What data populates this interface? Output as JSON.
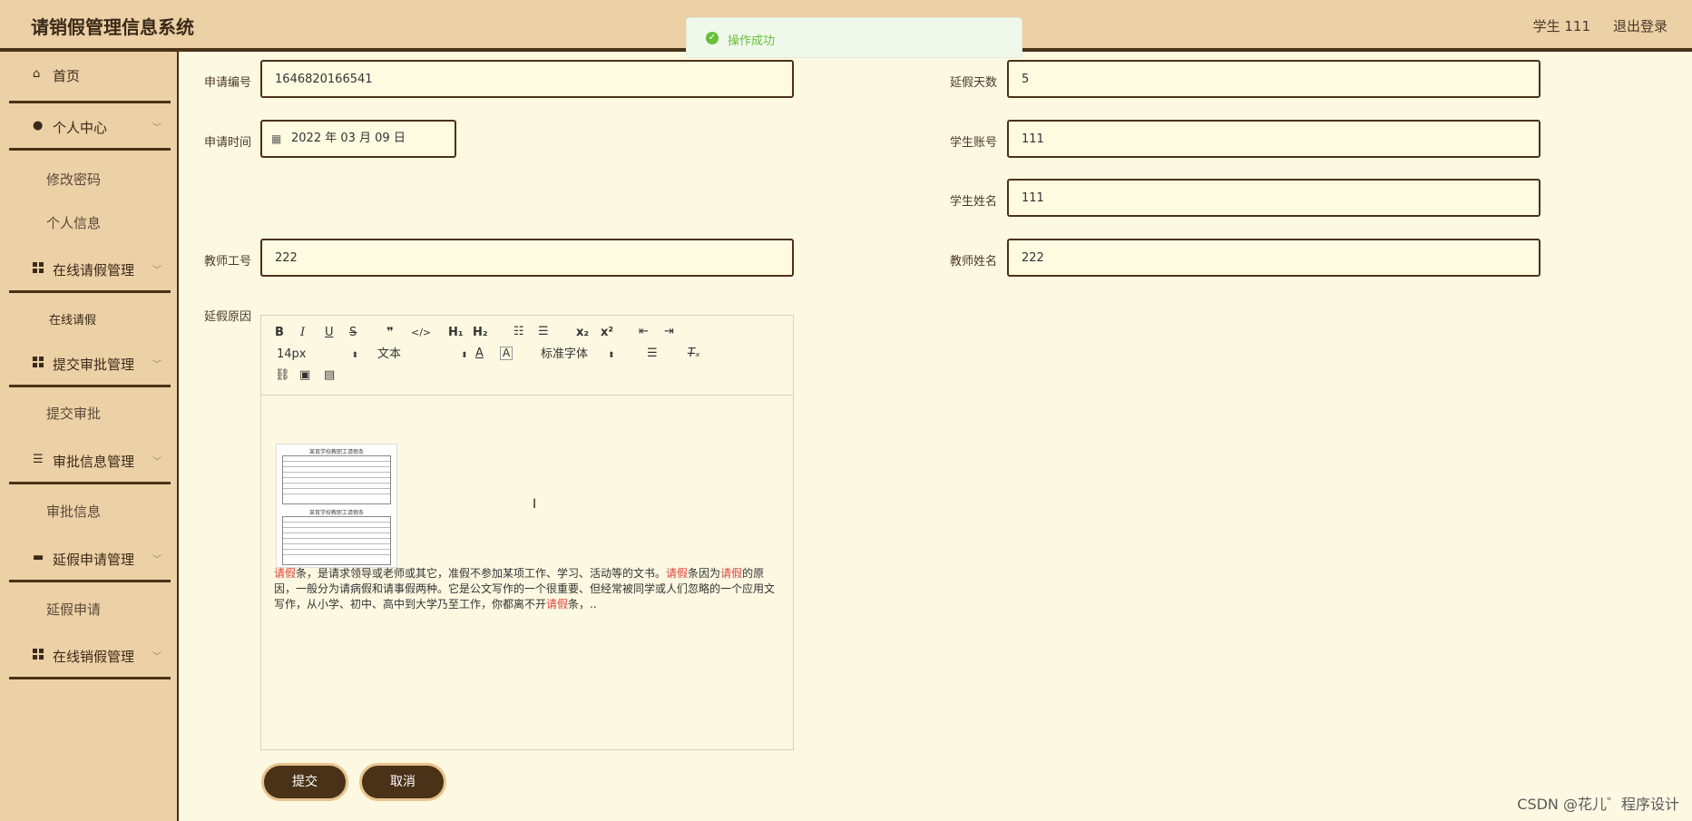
{
  "app": {
    "title": "请销假管理信息系统",
    "user_label": "学生 111",
    "logout_label": "退出登录"
  },
  "toast": {
    "message": "操作成功"
  },
  "sidebar": {
    "menus": [
      {
        "label": "首页"
      },
      {
        "label": "个人中心",
        "sub": [
          "修改密码",
          "个人信息"
        ]
      },
      {
        "label": "在线请假管理",
        "sub": [
          "在线请假"
        ]
      },
      {
        "label": "提交审批管理",
        "sub": [
          "提交审批"
        ]
      },
      {
        "label": "审批信息管理",
        "sub": [
          "审批信息"
        ]
      },
      {
        "label": "延假申请管理",
        "sub": [
          "延假申请"
        ]
      },
      {
        "label": "在线销假管理"
      }
    ]
  },
  "form": {
    "apply_no": {
      "label": "申请编号",
      "value": "1646820166541"
    },
    "extend_days": {
      "label": "延假天数",
      "value": "5"
    },
    "apply_time": {
      "label": "申请时间",
      "value": "2022 年 03 月 09 日"
    },
    "student_account": {
      "label": "学生账号",
      "value": "111"
    },
    "student_name": {
      "label": "学生姓名",
      "value": "111"
    },
    "teacher_no": {
      "label": "教师工号",
      "value": "222"
    },
    "teacher_name": {
      "label": "教师姓名",
      "value": "222"
    },
    "reason": {
      "label": "延假原因"
    }
  },
  "editor": {
    "font_size": "14px",
    "block_type": "文本",
    "font_family": "标准字体",
    "doc_image_title": "某育学校教职工请假条",
    "paragraph": [
      {
        "text": "请假",
        "hl": true
      },
      {
        "text": "条，是请求领导或老师或其它，准假不参加某项工作、学习、活动等的文书。",
        "hl": false
      },
      {
        "text": "请假",
        "hl": true
      },
      {
        "text": "条因为",
        "hl": false
      },
      {
        "text": "请假",
        "hl": true
      },
      {
        "text": "的原因，一般分为请病假和请事假两种。它是公文写作的一个很重要、但经常被同学或人们忽略的一个应用文写作，从小学、初中、高中到大学乃至工作，你都离不开",
        "hl": false
      },
      {
        "text": "请假",
        "hl": true
      },
      {
        "text": "条，..",
        "hl": false
      }
    ]
  },
  "buttons": {
    "submit": "提交",
    "cancel": "取消"
  },
  "watermark": "CSDN @花儿゛程序设计"
}
